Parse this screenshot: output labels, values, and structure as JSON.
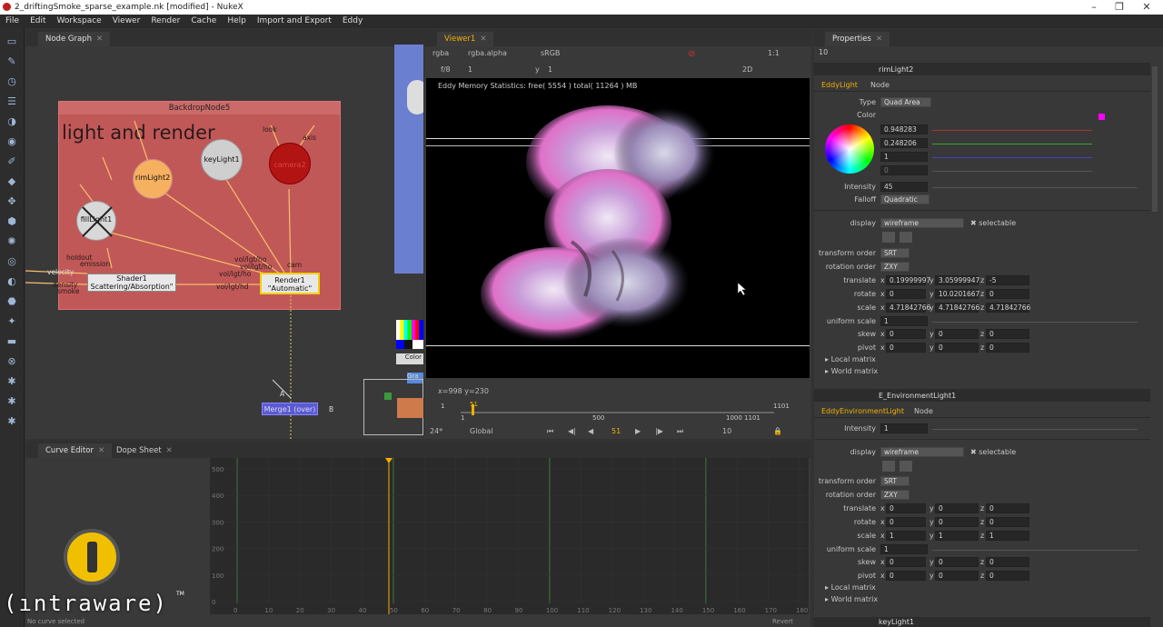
{
  "window": {
    "title": "2_driftingSmoke_sparse_example.nk [modified] - NukeX",
    "controls": [
      "–",
      "❐",
      "✕"
    ]
  },
  "menu": [
    "File",
    "Edit",
    "Workspace",
    "Viewer",
    "Render",
    "Cache",
    "Help",
    "Import and Export",
    "Eddy"
  ],
  "node_graph": {
    "tab": "Node Graph",
    "backdrop_title": "BackdropNode5",
    "backdrop_label": "light and render",
    "nodes": {
      "rimlight2": "rimLight2",
      "keylight1": "keyLight1",
      "camera2": "camera2",
      "filllight1": "fillLight1",
      "shader_line1": "Shader1",
      "shader_line2": "Scattering/Absorption\"",
      "render_line1": "Render1",
      "render_line2": "\"Automatic\"",
      "merge": "Merge1 (over)"
    },
    "labels": {
      "look": "look",
      "axis": "axis",
      "holdout": "holdout",
      "emission": "emission",
      "velocity": "velocity",
      "density": "density",
      "smoke": "smoke",
      "cam": "cam",
      "volho1": "vol/lgt/ho",
      "volho2": "vol/lgt/ho",
      "volho3": "vol/lgt/ho",
      "volho4": "vol/lgt/hd",
      "a": "A",
      "b": "B",
      "color": "Color",
      "gra": "Gra"
    }
  },
  "viewer": {
    "tab": "Viewer1",
    "channels": "rgba",
    "alpha": "rgba.alpha",
    "colorspace": "sRGB",
    "ratio": "1:1",
    "fstop": "f/8",
    "frame_one": "1",
    "y_label": "y",
    "y_value": "1",
    "mode": "2D",
    "stats": "Eddy Memory Statistics: free( 5554 ) total( 11264 ) MB",
    "coords": "x=998 y=230",
    "timeline": {
      "start": "1",
      "mid": "500",
      "end_range": "1000 1101",
      "end": "1101",
      "current_marker": "51",
      "fps": "24*",
      "scope": "Global",
      "frame": "51",
      "step": "10"
    }
  },
  "properties": {
    "tab": "Properties",
    "count": "10",
    "eddy_light": {
      "name": "rimLight2",
      "tabs": [
        "EddyLight",
        "Node"
      ],
      "type_label": "Type",
      "type": "Quad Area",
      "color_label": "Color",
      "rgb": [
        "0.948283",
        "0.248206",
        "1",
        "0"
      ],
      "intensity_label": "Intensity",
      "intensity": "45",
      "falloff_label": "Falloff",
      "falloff": "Quadratic",
      "display_label": "display",
      "display": "wireframe",
      "selectable": "selectable",
      "transform_order_label": "transform order",
      "transform_order": "SRT",
      "rotation_order_label": "rotation order",
      "rotation_order": "ZXY",
      "translate_label": "translate",
      "translate": [
        "0.19999997",
        "3.05999947",
        "-5"
      ],
      "rotate_label": "rotate",
      "rotate": [
        "0",
        "10.0201667",
        "0"
      ],
      "scale_label": "scale",
      "scale": [
        "4.71842766",
        "4.71842766",
        "4.71842766"
      ],
      "uniform_scale_label": "uniform scale",
      "uniform_scale": "1",
      "skew_label": "skew",
      "skew": [
        "0",
        "0",
        "0"
      ],
      "pivot_label": "pivot",
      "pivot": [
        "0",
        "0",
        "0"
      ],
      "local_matrix": "Local matrix",
      "world_matrix": "World matrix"
    },
    "env_light": {
      "name": "E_EnvironmentLight1",
      "tabs": [
        "EddyEnvironmentLight",
        "Node"
      ],
      "intensity_label": "Intensity",
      "intensity": "1",
      "display_label": "display",
      "display": "wireframe",
      "selectable": "selectable",
      "transform_order_label": "transform order",
      "transform_order": "SRT",
      "rotation_order_label": "rotation order",
      "rotation_order": "ZXY",
      "translate_label": "translate",
      "translate": [
        "0",
        "0",
        "0"
      ],
      "rotate_label": "rotate",
      "rotate": [
        "0",
        "0",
        "0"
      ],
      "scale_label": "scale",
      "scale": [
        "1",
        "1",
        "1"
      ],
      "uniform_scale_label": "uniform scale",
      "uniform_scale": "1",
      "skew_label": "skew",
      "skew": [
        "0",
        "0",
        "0"
      ],
      "pivot_label": "pivot",
      "pivot": [
        "0",
        "0",
        "0"
      ],
      "local_matrix": "Local matrix",
      "world_matrix": "World matrix"
    },
    "next_node": "keyLight1",
    "axis_x": "x",
    "axis_y": "y",
    "axis_z": "z"
  },
  "curve_editor": {
    "tabs": [
      "Curve Editor",
      "Dope Sheet"
    ],
    "status": "No curve selected",
    "revert": "Revert",
    "y_ticks": [
      "500",
      "400",
      "300",
      "200",
      "100",
      "0"
    ],
    "x_ticks": [
      "0",
      "10",
      "20",
      "30",
      "40",
      "50",
      "60",
      "70",
      "80",
      "90",
      "100",
      "110",
      "120",
      "130",
      "140",
      "150",
      "160",
      "170",
      "180"
    ]
  },
  "watermark": {
    "text": "(ıntraware)",
    "tm": "TM"
  },
  "colors": {
    "accent": "#f0b000",
    "backdrop": "#c15858"
  }
}
